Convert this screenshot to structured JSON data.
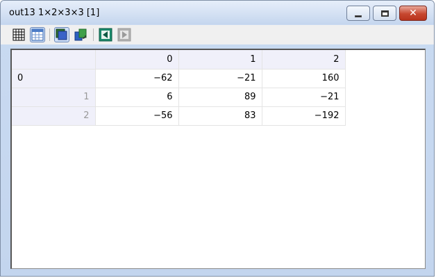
{
  "window": {
    "title": "out13 1×2×3×3 [1]",
    "controls": [
      "minimize-icon",
      "maximize-icon",
      "close-icon"
    ],
    "close_glyph": "✕"
  },
  "toolbar": {
    "buttons": [
      "grid-icon",
      "table-view-icon",
      "layer-icon",
      "rotate-icon",
      "prev-icon",
      "next-icon"
    ]
  },
  "table": {
    "columns": [
      "0",
      "1",
      "2"
    ],
    "rows": [
      {
        "label": "0",
        "values": [
          "−62",
          "−21",
          "160"
        ]
      },
      {
        "label": "1",
        "values": [
          "6",
          "89",
          "−21"
        ]
      },
      {
        "label": "2",
        "values": [
          "−56",
          "83",
          "−192"
        ]
      }
    ]
  },
  "colors": {
    "header_bg": "#f0f0fa",
    "close_red": "#c7472f",
    "frame_blue": "#c9daf1"
  }
}
